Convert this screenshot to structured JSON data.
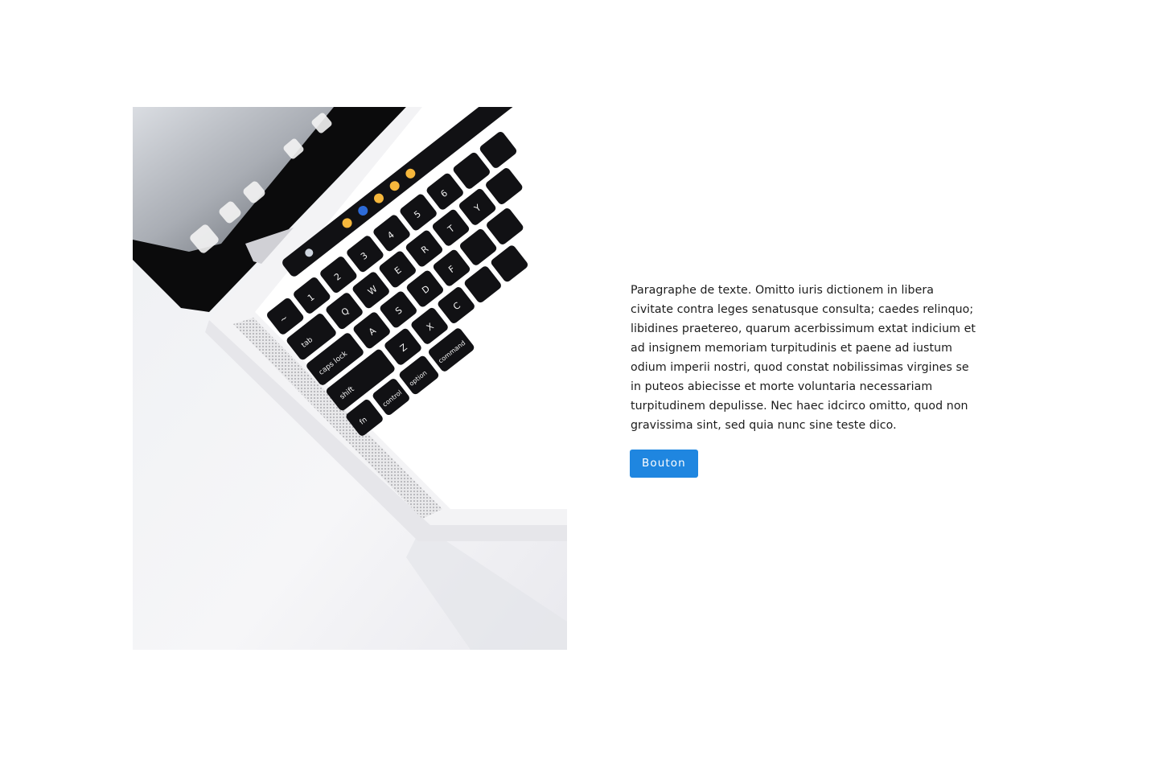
{
  "content": {
    "paragraph": "Paragraphe de texte. Omitto iuris dictionem in libera civitate contra leges senatusque consulta; caedes relinquo; libidines praetereo, quarum acerbissimum extat indicium et ad insignem memoriam turpitudinis et paene ad iustum odium imperii nostri, quod constat nobilissimas virgines se in puteos abiecisse et morte voluntaria necessariam turpitudinem depulisse. Nec haec idcirco omitto, quod non gravissima sint, sed quia nunc sine teste dico.",
    "button_label": "Bouton"
  },
  "media": {
    "subject": "laptop-keyboard-photo",
    "keys": [
      "tab",
      "caps lock",
      "shift",
      "fn",
      "control",
      "option",
      "command",
      "~",
      "!",
      "1",
      "@",
      "2",
      "#",
      "3",
      "$",
      "4",
      "%",
      "5",
      "^",
      "6",
      "Q",
      "W",
      "E",
      "R",
      "T",
      "Y",
      "A",
      "S",
      "D",
      "F",
      "Z",
      "X",
      "C"
    ]
  },
  "colors": {
    "accent": "#1f86e0",
    "text": "#1c1c1c",
    "background": "#ffffff"
  }
}
